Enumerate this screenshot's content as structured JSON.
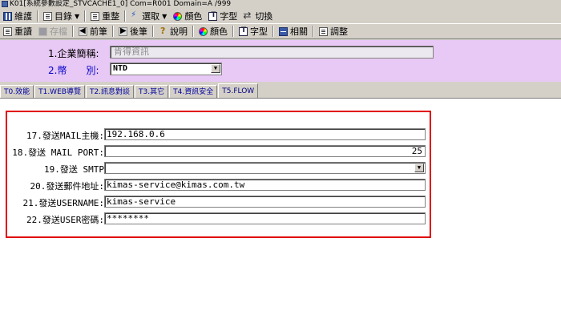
{
  "window": {
    "title": "K01[系統參數設定_STVCACHE1_0] Com=R001 Domain=A /999"
  },
  "toolbar1": [
    {
      "label": "維護",
      "icon": "grid-icon",
      "dropdown": false
    },
    {
      "label": "目錄",
      "icon": "doc-icon",
      "dropdown": true
    },
    {
      "label": "重整",
      "icon": "doc-icon",
      "dropdown": false
    },
    {
      "label": "選取",
      "icon": "select-icon",
      "dropdown": true
    },
    {
      "label": "顏色",
      "icon": "color-icon",
      "dropdown": false
    },
    {
      "label": "字型",
      "icon": "font-icon",
      "dropdown": false
    },
    {
      "label": "切換",
      "icon": "swap-icon",
      "dropdown": false
    }
  ],
  "toolbar2": [
    {
      "label": "重讀",
      "icon": "doc-icon",
      "enabled": true
    },
    {
      "label": "存檔",
      "icon": "save-icon",
      "enabled": false
    },
    {
      "label": "前筆",
      "icon": "arrow-left-icon",
      "enabled": true
    },
    {
      "label": "後筆",
      "icon": "arrow-right-icon",
      "enabled": true
    },
    {
      "label": "說明",
      "icon": "help-icon",
      "enabled": true
    },
    {
      "label": "顏色",
      "icon": "color-icon",
      "enabled": true
    },
    {
      "label": "字型",
      "icon": "font-icon",
      "enabled": true
    },
    {
      "label": "相關",
      "icon": "link-icon",
      "enabled": true
    },
    {
      "label": "調整",
      "icon": "doc-icon",
      "enabled": true
    }
  ],
  "header": {
    "company_label": "1.企業簡稱:",
    "company_value": "肯得資訊",
    "currency_label": "2.幣　　別:",
    "currency_value": "NTD"
  },
  "tabs": [
    "T0.效能",
    "T1.WEB導覽",
    "T2.訊息對談",
    "T3.其它",
    "T4.資訊安全",
    "T5.FLOW"
  ],
  "active_tab": "T5.FLOW",
  "form": {
    "rows": [
      {
        "label": "17.發送MAIL主機:",
        "value": "192.168.0.6",
        "align": "left",
        "type": "text"
      },
      {
        "label": "18.發送 MAIL PORT:",
        "value": "25",
        "align": "right",
        "type": "text"
      },
      {
        "label": "19.發送 SMTP",
        "value": "",
        "align": "left",
        "type": "select"
      },
      {
        "label": "20.發送郵件地址:",
        "value": "kimas-service@kimas.com.tw",
        "align": "left",
        "type": "text"
      },
      {
        "label": "21.發送USERNAME:",
        "value": "kimas-service",
        "align": "left",
        "type": "text"
      },
      {
        "label": "22.發送USER密碼:",
        "value": "********",
        "align": "left",
        "type": "text"
      }
    ]
  },
  "colors": {
    "header_bg": "#e8c8f4",
    "highlight_border": "#e00000",
    "tab_text": "#0000a0"
  }
}
